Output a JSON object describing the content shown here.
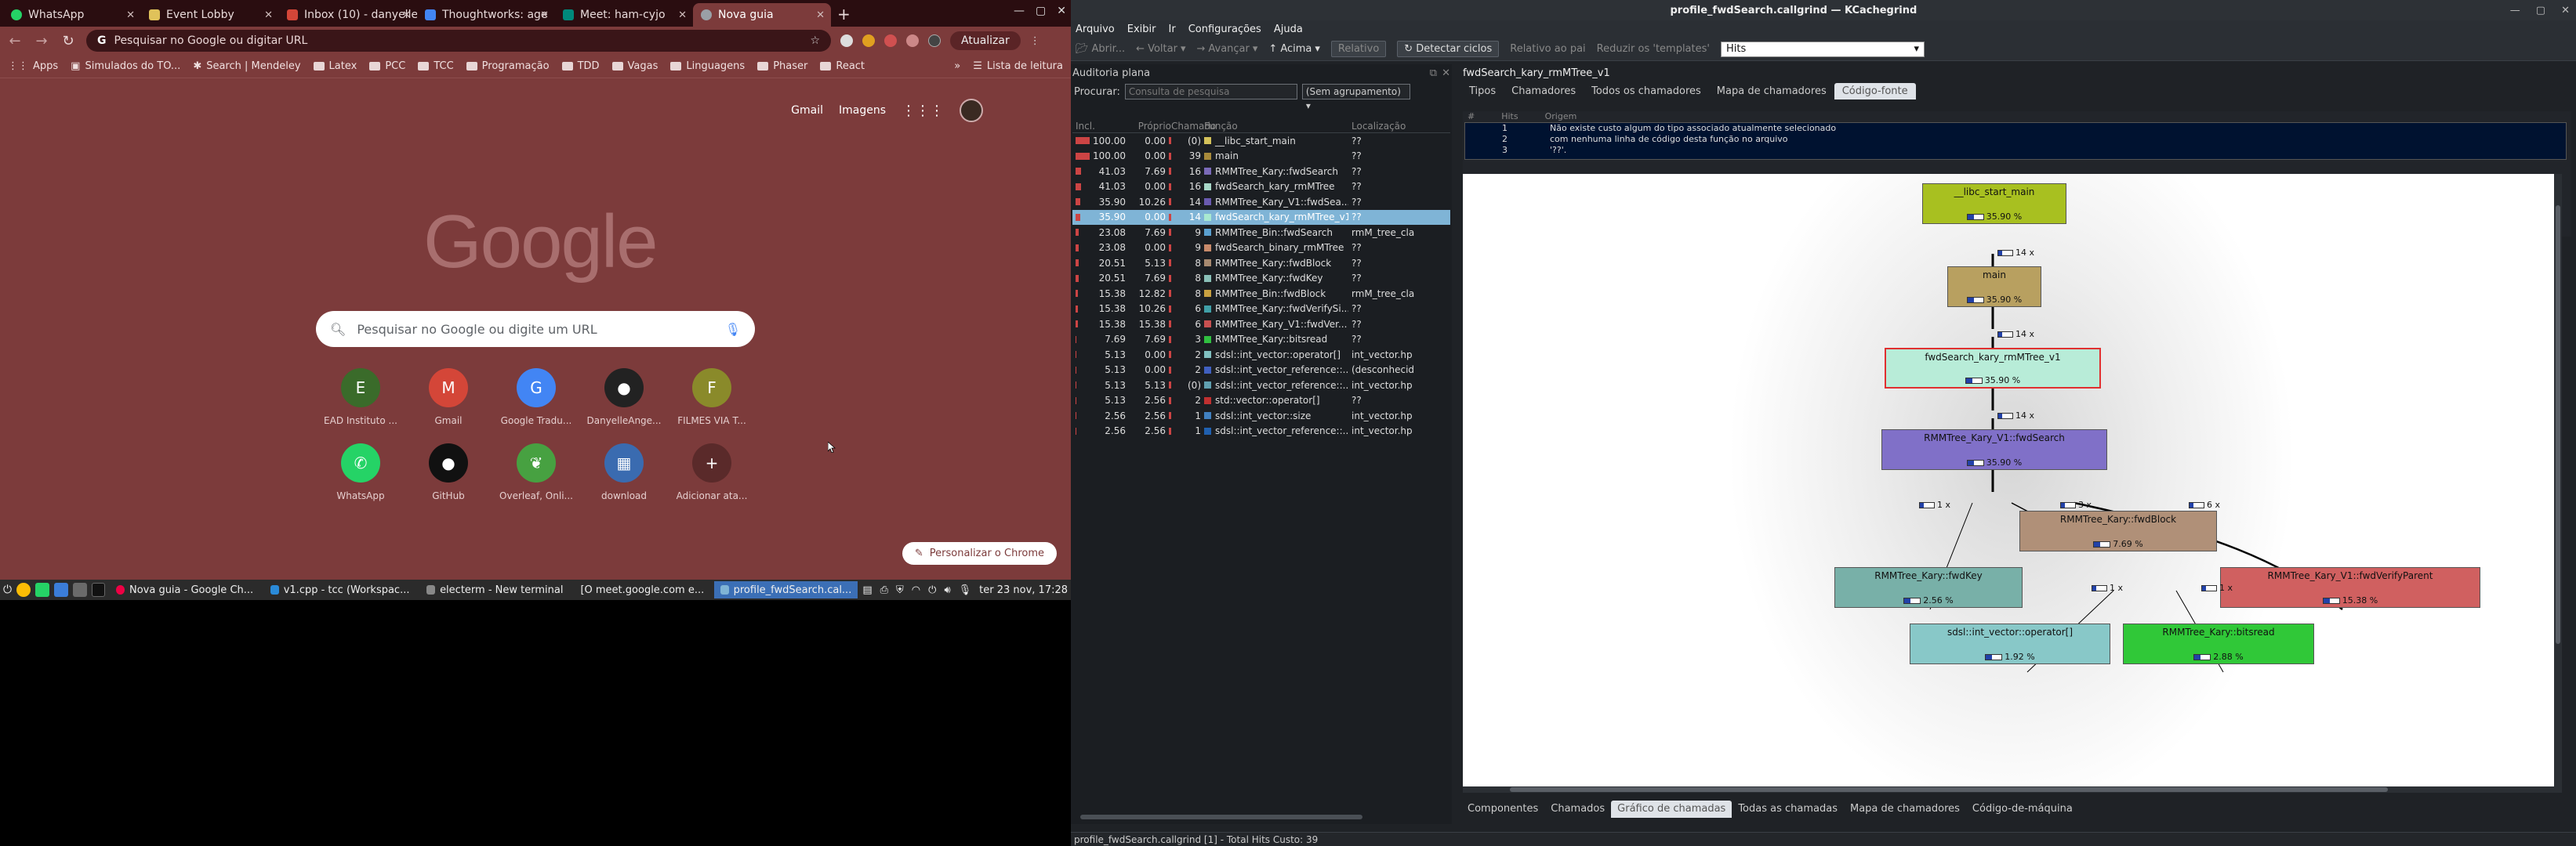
{
  "chrome": {
    "tabs": [
      {
        "title": "WhatsApp",
        "color": "#25d366"
      },
      {
        "title": "Event Lobby",
        "color": "#e0c25a"
      },
      {
        "title": "Inbox (10) - danyelle",
        "color": "#d44638"
      },
      {
        "title": "Thoughtworks: age",
        "color": "#4285f4"
      },
      {
        "title": "Meet: ham-cyjo",
        "color": "#00897b"
      },
      {
        "title": "Nova guia",
        "color": "#9aa0a6"
      }
    ],
    "new_tab": "+",
    "omnibox_text": "Pesquisar no Google ou digitar URL",
    "update_label": "Atualizar",
    "bookmarks": [
      "Apps",
      "Simulados do TO...",
      "Search | Mendeley",
      "Latex",
      "PCC",
      "TCC",
      "Programação",
      "TDD",
      "Vagas",
      "Linguagens",
      "Phaser",
      "React"
    ],
    "reading_list": "Lista de leitura",
    "ntp_links": [
      "Gmail",
      "Imagens"
    ],
    "logo": "Google",
    "search_placeholder": "Pesquisar no Google ou digite um URL",
    "shortcuts": [
      {
        "label": "EAD Instituto ...",
        "glyph": "E",
        "color": "#3a6b2a"
      },
      {
        "label": "Gmail",
        "glyph": "M",
        "color": "#d44638"
      },
      {
        "label": "Google Tradu...",
        "glyph": "G",
        "color": "#4285f4"
      },
      {
        "label": "DanyelleAnge...",
        "glyph": "●",
        "color": "#222"
      },
      {
        "label": "FILMES VIA T...",
        "glyph": "F",
        "color": "#8a8a2a"
      },
      {
        "label": "WhatsApp",
        "glyph": "✆",
        "color": "#25d366"
      },
      {
        "label": "GitHub",
        "glyph": "●",
        "color": "#111"
      },
      {
        "label": "Overleaf, Onli...",
        "glyph": "❦",
        "color": "#47a141"
      },
      {
        "label": "download",
        "glyph": "▦",
        "color": "#3a6bb0"
      },
      {
        "label": "Adicionar ata...",
        "glyph": "+",
        "color": "#5a2a2a"
      }
    ],
    "customize_label": "Personalizar o Chrome"
  },
  "taskbar": {
    "items": [
      "Nova guia - Google Ch...",
      "v1.cpp - tcc (Workspac...",
      "electerm - New terminal",
      "[O meet.google.com e...",
      "profile_fwdSearch.cal..."
    ],
    "clock": "ter 23 nov, 17:28"
  },
  "kc": {
    "title": "profile_fwdSearch.callgrind — KCachegrind",
    "menu": [
      "Arquivo",
      "Exibir",
      "Ir",
      "Configurações",
      "Ajuda"
    ],
    "toolbar": [
      "Abrir...",
      "Voltar",
      "Avançar",
      "Acima",
      "Relativo",
      "Detectar ciclos",
      "Relativo ao pai",
      "Reduzir os 'templates'"
    ],
    "event_type": "Hits",
    "flat": {
      "title": "Auditoria plana",
      "search_label": "Procurar:",
      "search_placeholder": "Consulta de pesquisa",
      "grouping": "(Sem agrupamento)",
      "columns": [
        "Incl.",
        "Próprio",
        "Chamado",
        "Função",
        "Localização"
      ],
      "rows": [
        {
          "incl": "100.00",
          "self": "0.00",
          "called": "(0)",
          "func": "__libc_start_main",
          "loc": "??",
          "color": "#d4c25a",
          "bar": 1.0
        },
        {
          "incl": "100.00",
          "self": "0.00",
          "called": "39",
          "func": "main",
          "loc": "??",
          "color": "#a88a3a",
          "bar": 1.0
        },
        {
          "incl": "41.03",
          "self": "7.69",
          "called": "16",
          "func": "RMMTree_Kary::fwdSearch",
          "loc": "??",
          "color": "#7a6ab8",
          "bar": 0.41
        },
        {
          "incl": "41.03",
          "self": "0.00",
          "called": "16",
          "func": "fwdSearch_kary_rmMTree",
          "loc": "??",
          "color": "#a8d8c8",
          "bar": 0.41
        },
        {
          "incl": "35.90",
          "self": "10.26",
          "called": "14",
          "func": "RMMTree_Kary_V1::fwdSea...",
          "loc": "??",
          "color": "#6a5ab0",
          "bar": 0.36
        },
        {
          "incl": "35.90",
          "self": "0.00",
          "called": "14",
          "func": "fwdSearch_kary_rmMTree_v1",
          "loc": "??",
          "color": "#a8e8d0",
          "bar": 0.36,
          "selected": true
        },
        {
          "incl": "23.08",
          "self": "7.69",
          "called": "9",
          "func": "RMMTree_Bin::fwdSearch",
          "loc": "rmM_tree_cla",
          "color": "#5aa0d0",
          "bar": 0.23
        },
        {
          "incl": "23.08",
          "self": "0.00",
          "called": "9",
          "func": "fwdSearch_binary_rmMTree",
          "loc": "??",
          "color": "#c88a6a",
          "bar": 0.23
        },
        {
          "incl": "20.51",
          "self": "5.13",
          "called": "8",
          "func": "RMMTree_Kary::fwdBlock",
          "loc": "??",
          "color": "#a88a70",
          "bar": 0.21
        },
        {
          "incl": "20.51",
          "self": "7.69",
          "called": "8",
          "func": "RMMTree_Kary::fwdKey",
          "loc": "??",
          "color": "#8ac0b8",
          "bar": 0.21
        },
        {
          "incl": "15.38",
          "self": "12.82",
          "called": "8",
          "func": "RMMTree_Bin::fwdBlock",
          "loc": "rmM_tree_cla",
          "color": "#c8a040",
          "bar": 0.15
        },
        {
          "incl": "15.38",
          "self": "10.26",
          "called": "6",
          "func": "RMMTree_Kary::fwdVerifySi...",
          "loc": "??",
          "color": "#40a0a8",
          "bar": 0.15
        },
        {
          "incl": "15.38",
          "self": "15.38",
          "called": "6",
          "func": "RMMTree_Kary_V1::fwdVer...",
          "loc": "??",
          "color": "#c85050",
          "bar": 0.15
        },
        {
          "incl": "7.69",
          "self": "7.69",
          "called": "3",
          "func": "RMMTree_Kary::bitsread",
          "loc": "??",
          "color": "#30c040",
          "bar": 0.08
        },
        {
          "incl": "5.13",
          "self": "0.00",
          "called": "2",
          "func": "sdsl::int_vector::operator[]",
          "loc": "int_vector.hp",
          "color": "#80c0c0",
          "bar": 0
        },
        {
          "incl": "5.13",
          "self": "0.00",
          "called": "2",
          "func": "sdsl::int_vector_reference::...",
          "loc": "(desconhecid",
          "color": "#4060c0",
          "bar": 0
        },
        {
          "incl": "5.13",
          "self": "5.13",
          "called": "(0)",
          "func": "sdsl::int_vector_reference::...",
          "loc": "int_vector.hp",
          "color": "#60a0b0",
          "bar": 0
        },
        {
          "incl": "5.13",
          "self": "2.56",
          "called": "2",
          "func": "std::vector::operator[]",
          "loc": "??",
          "color": "#c03030",
          "bar": 0
        },
        {
          "incl": "2.56",
          "self": "2.56",
          "called": "1",
          "func": "sdsl::int_vector::size",
          "loc": "int_vector.hp",
          "color": "#4080c0",
          "bar": 0
        },
        {
          "incl": "2.56",
          "self": "2.56",
          "called": "1",
          "func": "sdsl::int_vector_reference::...",
          "loc": "int_vector.hp",
          "color": "#2060b0",
          "bar": 0
        }
      ]
    },
    "detail": {
      "title": "fwdSearch_kary_rmMTree_v1",
      "tabs": [
        "Tipos",
        "Chamadores",
        "Todos os chamadores",
        "Mapa de chamadores",
        "Código-fonte"
      ],
      "src_cols": [
        "#",
        "Hits",
        "Origem"
      ],
      "src_lines": [
        {
          "n": "1",
          "t": "Não existe custo algum do tipo associado atualmente selecionado"
        },
        {
          "n": "2",
          "t": "com nenhuma linha de código desta função no arquivo"
        },
        {
          "n": "3",
          "t": "'??'."
        }
      ],
      "nodes": [
        {
          "id": "n1",
          "name": "__libc_start_main",
          "pct": "35.90 %",
          "color": "#a8c020"
        },
        {
          "id": "n2",
          "name": "main",
          "pct": "35.90 %",
          "color": "#b8a060"
        },
        {
          "id": "n3",
          "name": "fwdSearch_kary_rmMTree_v1",
          "pct": "35.90 %",
          "color": "#b8ecd8"
        },
        {
          "id": "n4",
          "name": "RMMTree_Kary_V1::fwdSearch",
          "pct": "35.90 %",
          "color": "#8070c8"
        },
        {
          "id": "n5",
          "name": "RMMTree_Kary::fwdBlock",
          "pct": "7.69 %",
          "color": "#b09078"
        },
        {
          "id": "n6",
          "name": "RMMTree_Kary::fwdKey",
          "pct": "2.56 %",
          "color": "#78b0a8"
        },
        {
          "id": "n7",
          "name": "RMMTree_Kary_V1::fwdVerifyParent",
          "pct": "15.38 %",
          "color": "#d06060"
        },
        {
          "id": "n8",
          "name": "sdsl::int_vector::operator[]",
          "pct": "1.92 %",
          "color": "#88c8c8"
        },
        {
          "id": "n9",
          "name": "RMMTree_Kary::bitsread",
          "pct": "2.88 %",
          "color": "#30c838"
        }
      ],
      "edges": [
        "14 x",
        "14 x",
        "14 x",
        "1 x",
        "3 x",
        "6 x",
        "1 x",
        "1 x"
      ],
      "bottom_tabs": [
        "Componentes",
        "Chamados",
        "Gráfico de chamadas",
        "Todas as chamadas",
        "Mapa de chamadores",
        "Código-de-máquina"
      ]
    },
    "status": "profile_fwdSearch.callgrind [1] - Total Hits Custo: 39"
  }
}
